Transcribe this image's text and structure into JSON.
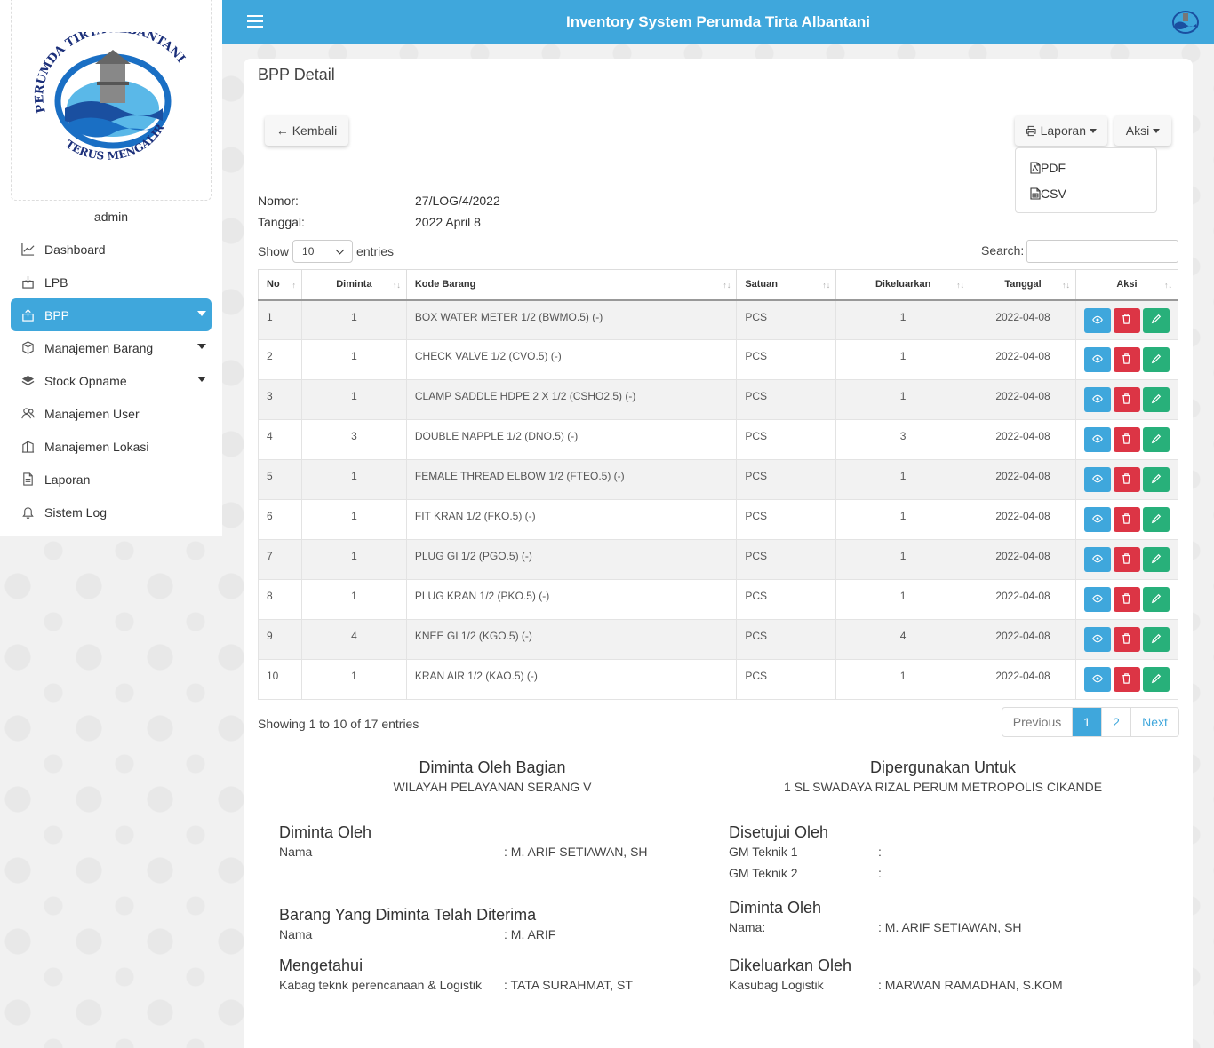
{
  "app": {
    "title": "Inventory System Perumda Tirta Albantani"
  },
  "user": {
    "name": "admin"
  },
  "logo": {
    "top_text": "PERUMDA TIRTA ALBANTANI",
    "bottom_text": "TERUS MENGALIR"
  },
  "sidebar": {
    "items": [
      {
        "label": "Dashboard",
        "icon": "chart-line-icon"
      },
      {
        "label": "LPB",
        "icon": "inbox-in-icon"
      },
      {
        "label": "BPP",
        "icon": "inbox-out-icon",
        "active": true
      },
      {
        "label": "Manajemen Barang",
        "icon": "box-icon"
      },
      {
        "label": "Stock Opname",
        "icon": "layers-icon"
      },
      {
        "label": "Manajemen User",
        "icon": "users-icon"
      },
      {
        "label": "Manajemen Lokasi",
        "icon": "building-icon"
      },
      {
        "label": "Laporan",
        "icon": "file-icon"
      },
      {
        "label": "Sistem Log",
        "icon": "bell-icon"
      }
    ]
  },
  "page": {
    "title": "BPP Detail",
    "back_label": "Kembali",
    "laporan_label": "Laporan",
    "aksi_label": "Aksi",
    "dropdown": {
      "pdf": "PDF",
      "csv": "CSV"
    },
    "nomor_label": "Nomor:",
    "nomor_value": "27/LOG/4/2022",
    "tanggal_label": "Tanggal:",
    "tanggal_value": "2022 April 8"
  },
  "table": {
    "show_label": "Show",
    "entries_label": "entries",
    "page_size": "10",
    "search_label": "Search:",
    "headers": {
      "no": "No",
      "diminta": "Diminta",
      "kode": "Kode Barang",
      "satuan": "Satuan",
      "dikeluarkan": "Dikeluarkan",
      "tanggal": "Tanggal",
      "aksi": "Aksi"
    },
    "rows": [
      {
        "no": "1",
        "diminta": "1",
        "kode": "BOX WATER METER 1/2 (BWMO.5) (-)",
        "satuan": "PCS",
        "dikeluarkan": "1",
        "tanggal": "2022-04-08"
      },
      {
        "no": "2",
        "diminta": "1",
        "kode": "CHECK VALVE 1/2 (CVO.5) (-)",
        "satuan": "PCS",
        "dikeluarkan": "1",
        "tanggal": "2022-04-08"
      },
      {
        "no": "3",
        "diminta": "1",
        "kode": "CLAMP SADDLE HDPE 2 X 1/2 (CSHO2.5) (-)",
        "satuan": "PCS",
        "dikeluarkan": "1",
        "tanggal": "2022-04-08"
      },
      {
        "no": "4",
        "diminta": "3",
        "kode": "DOUBLE NAPPLE 1/2 (DNO.5) (-)",
        "satuan": "PCS",
        "dikeluarkan": "3",
        "tanggal": "2022-04-08"
      },
      {
        "no": "5",
        "diminta": "1",
        "kode": "FEMALE THREAD ELBOW 1/2 (FTEO.5) (-)",
        "satuan": "PCS",
        "dikeluarkan": "1",
        "tanggal": "2022-04-08"
      },
      {
        "no": "6",
        "diminta": "1",
        "kode": "FIT KRAN 1/2 (FKO.5) (-)",
        "satuan": "PCS",
        "dikeluarkan": "1",
        "tanggal": "2022-04-08"
      },
      {
        "no": "7",
        "diminta": "1",
        "kode": "PLUG GI 1/2 (PGO.5) (-)",
        "satuan": "PCS",
        "dikeluarkan": "1",
        "tanggal": "2022-04-08"
      },
      {
        "no": "8",
        "diminta": "1",
        "kode": "PLUG KRAN 1/2 (PKO.5) (-)",
        "satuan": "PCS",
        "dikeluarkan": "1",
        "tanggal": "2022-04-08"
      },
      {
        "no": "9",
        "diminta": "4",
        "kode": "KNEE GI 1/2 (KGO.5) (-)",
        "satuan": "PCS",
        "dikeluarkan": "4",
        "tanggal": "2022-04-08"
      },
      {
        "no": "10",
        "diminta": "1",
        "kode": "KRAN AIR 1/2 (KAO.5) (-)",
        "satuan": "PCS",
        "dikeluarkan": "1",
        "tanggal": "2022-04-08"
      }
    ],
    "info": "Showing 1 to 10 of 17 entries",
    "pager": {
      "prev": "Previous",
      "p1": "1",
      "p2": "2",
      "next": "Next"
    }
  },
  "footer": {
    "diminta_bagian_title": "Diminta Oleh Bagian",
    "diminta_bagian_value": "WILAYAH PELAYANAN SERANG V",
    "dipergunakan_title": "Dipergunakan Untuk",
    "dipergunakan_value": "1 SL SWADAYA RIZAL PERUM METROPOLIS CIKANDE",
    "diminta_oleh_title": "Diminta Oleh",
    "diminta_oleh_label": "Nama",
    "diminta_oleh_value": ": M. ARIF SETIAWAN, SH",
    "diterima_title": "Barang Yang Diminta Telah Diterima",
    "diterima_label": "Nama",
    "diterima_value": ": M. ARIF",
    "mengetahui_title": "Mengetahui",
    "mengetahui_label": "Kabag teknk perencanaan & Logistik",
    "mengetahui_value": ": TATA SURAHMAT, ST",
    "disetujui_title": "Disetujui Oleh",
    "gm1_label": "GM Teknik 1",
    "gm1_value": ":",
    "gm2_label": "GM Teknik 2",
    "gm2_value": ":",
    "diminta_oleh2_title": "Diminta Oleh",
    "diminta_oleh2_label": "Nama:",
    "diminta_oleh2_value": ": M. ARIF SETIAWAN, SH",
    "dikeluarkan_title": "Dikeluarkan Oleh",
    "dikeluarkan_label": "Kasubag Logistik",
    "dikeluarkan_value": ": MARWAN RAMADHAN, S.KOM"
  }
}
